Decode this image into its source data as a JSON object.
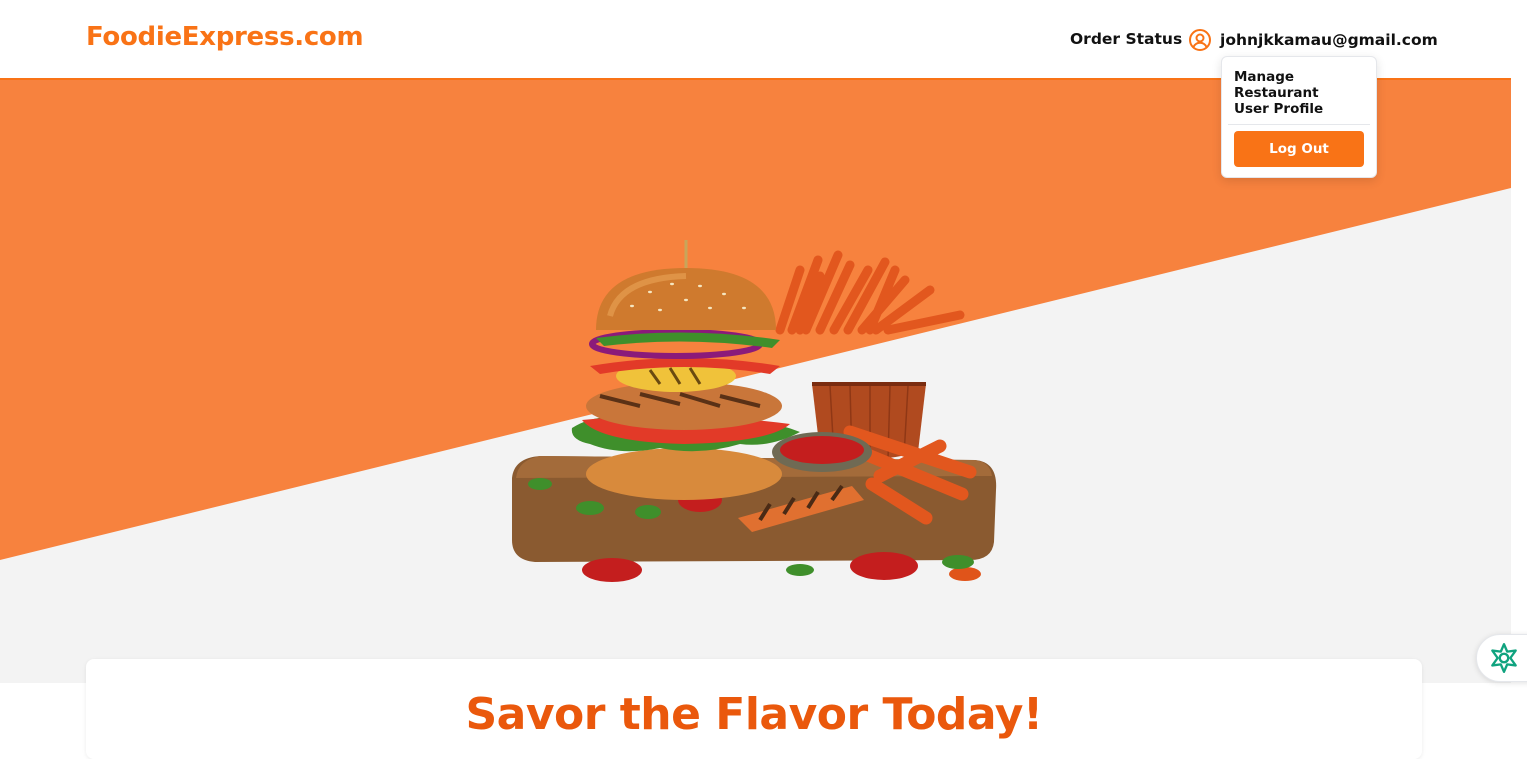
{
  "header": {
    "logo": "FoodieExpress.com",
    "order_status": "Order Status",
    "user_email": "johnjkkamau@gmail.com"
  },
  "dropdown": {
    "items": [
      "Manage Restaurant",
      "User Profile"
    ],
    "logout_label": "Log Out"
  },
  "hero": {
    "image": "burger-and-fries-image"
  },
  "card": {
    "title": "Savor the Flavor Today!"
  },
  "colors": {
    "accent": "#f97316",
    "hero_orange": "#f7823e",
    "hero_gray": "#f3f3f3",
    "title": "#ea580c"
  },
  "icons": {
    "user": "user-circle-icon",
    "assistant": "ai-assistant-icon"
  }
}
